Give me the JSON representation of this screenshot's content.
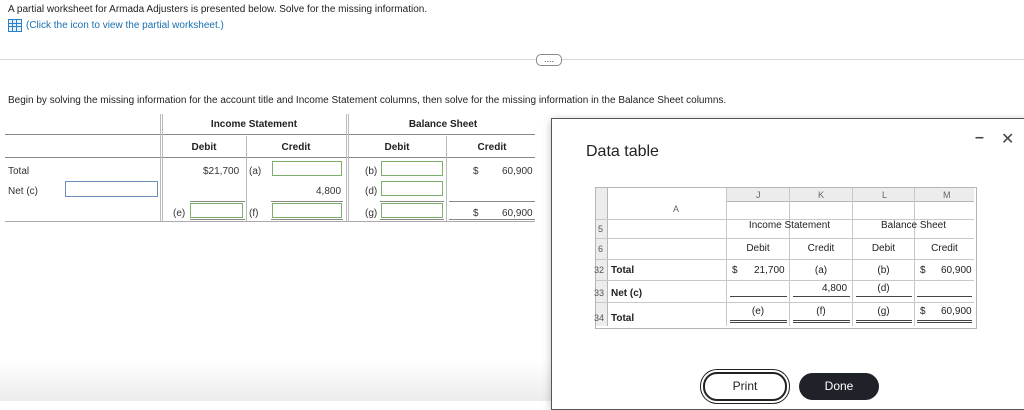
{
  "intro": {
    "line1": "A partial worksheet for Armada Adjusters is presented below. Solve for the missing information.",
    "link": "(Click the icon to view the partial worksheet.)"
  },
  "ellipsis": "....",
  "instruction": "Begin by solving the missing information for the account title and Income Statement columns, then solve for the missing information in the Balance Sheet columns.",
  "worksheet": {
    "group_income": "Income Statement",
    "group_balance": "Balance Sheet",
    "col_debit": "Debit",
    "col_credit": "Credit",
    "row_total": "Total",
    "row_net": "Net (c)",
    "is_debit_total": "$21,700",
    "lbl_a": "(a)",
    "is_credit_net": "4,800",
    "lbl_b": "(b)",
    "lbl_d": "(d)",
    "lbl_e": "(e)",
    "lbl_f": "(f)",
    "lbl_g": "(g)",
    "bs_credit_total_sym": "$",
    "bs_credit_total": "60,900",
    "bs_credit_final_sym": "$",
    "bs_credit_final": "60,900"
  },
  "modal": {
    "title": "Data table",
    "minimize": "–",
    "close": "✕",
    "col_letters": [
      "A",
      "J",
      "K",
      "L",
      "M"
    ],
    "row_nums": [
      "5",
      "6",
      "32",
      "33",
      "34"
    ],
    "income_statement": "Income Statement",
    "balance_sheet": "Balance Sheet",
    "debit": "Debit",
    "credit": "Credit",
    "total": "Total",
    "net": "Net (c)",
    "total2": "Total",
    "j_total_sym": "$",
    "j_total": "21,700",
    "k_total": "(a)",
    "l_total": "(b)",
    "m_total_sym": "$",
    "m_total": "60,900",
    "k_net": "4,800",
    "l_net": "(d)",
    "j_final": "(e)",
    "k_final": "(f)",
    "l_final": "(g)",
    "m_final_sym": "$",
    "m_final": "60,900",
    "print": "Print",
    "done": "Done"
  }
}
